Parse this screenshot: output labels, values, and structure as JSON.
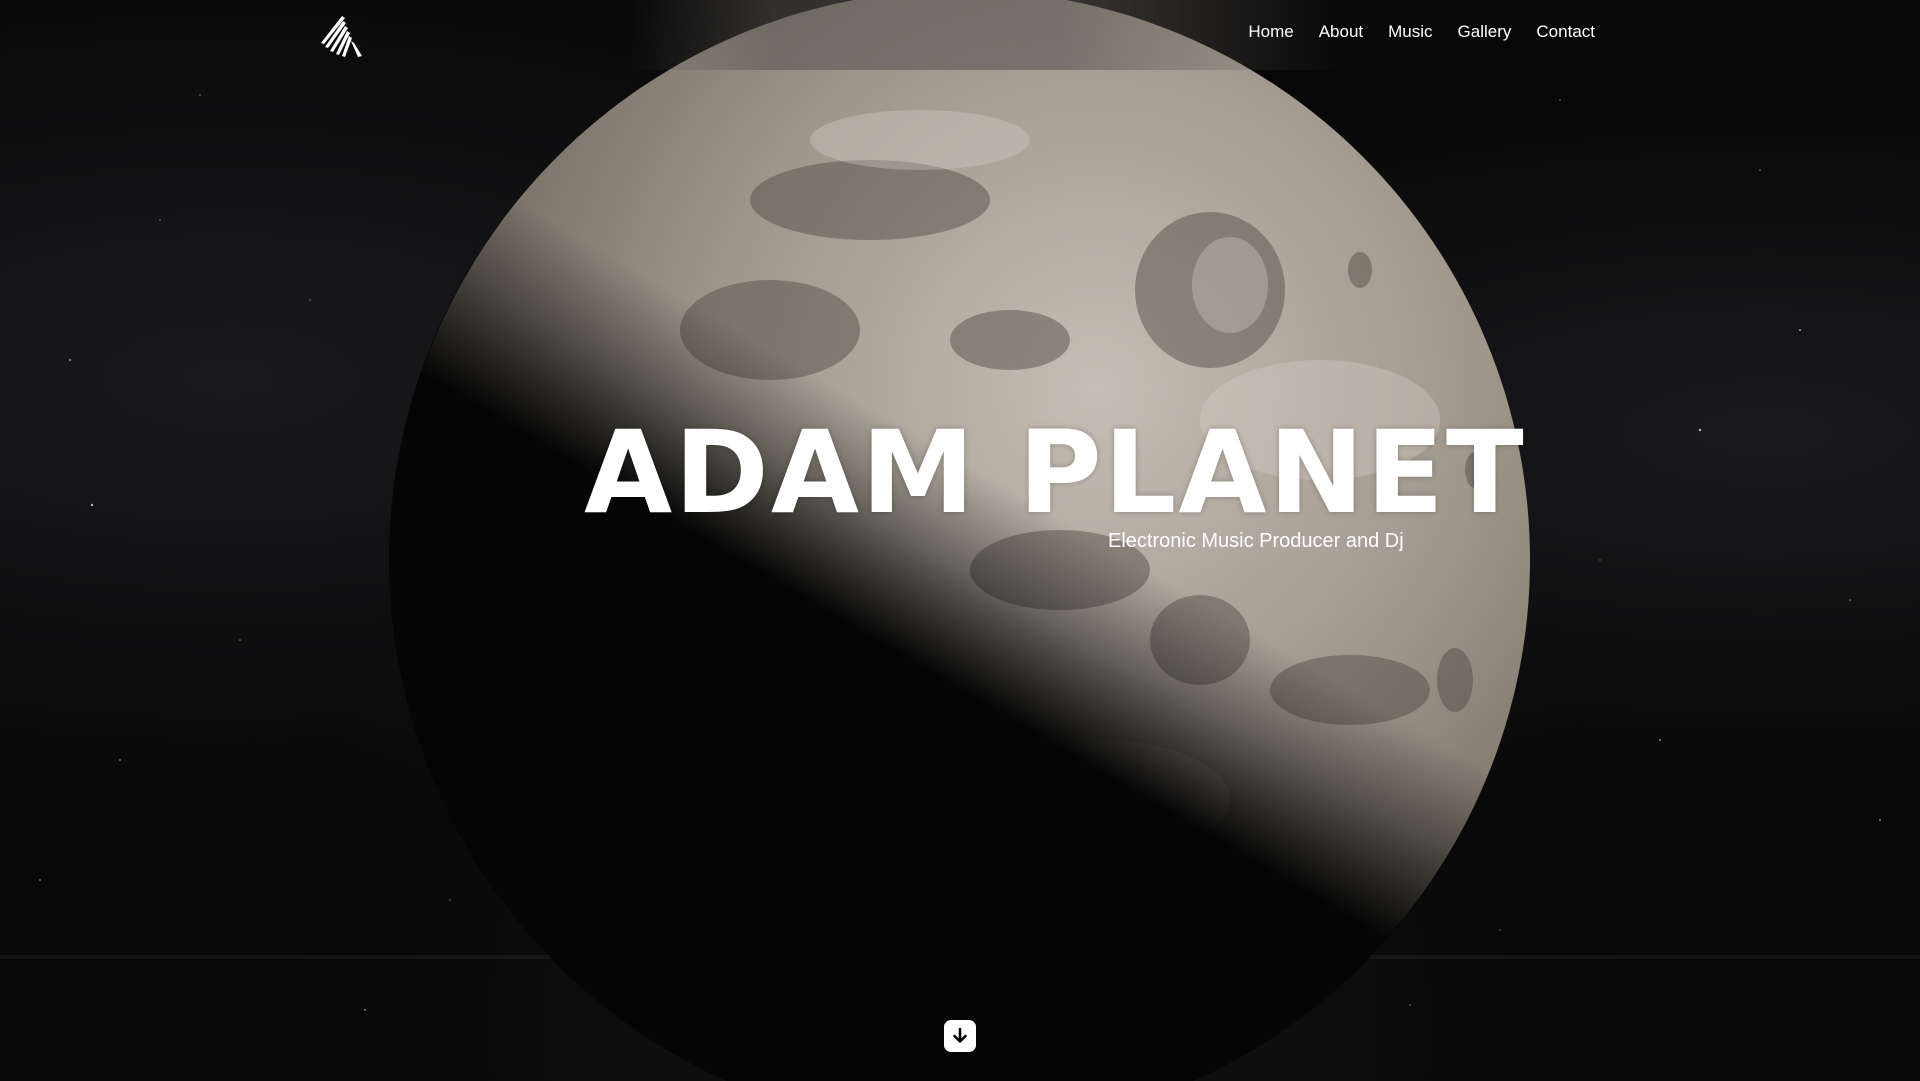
{
  "nav": {
    "logo_icon": "triangle-logo-icon",
    "links": [
      {
        "label": "Home"
      },
      {
        "label": "About"
      },
      {
        "label": "Music"
      },
      {
        "label": "Gallery"
      },
      {
        "label": "Contact"
      }
    ]
  },
  "hero": {
    "title": "ADAM PLANET",
    "subtitle": "Electronic Music Producer and Dj",
    "scroll_icon": "arrow-down-icon"
  },
  "colors": {
    "background": "#070707",
    "text": "#ffffff",
    "moon_light": "#a8a298",
    "moon_dark": "#5e5850"
  }
}
